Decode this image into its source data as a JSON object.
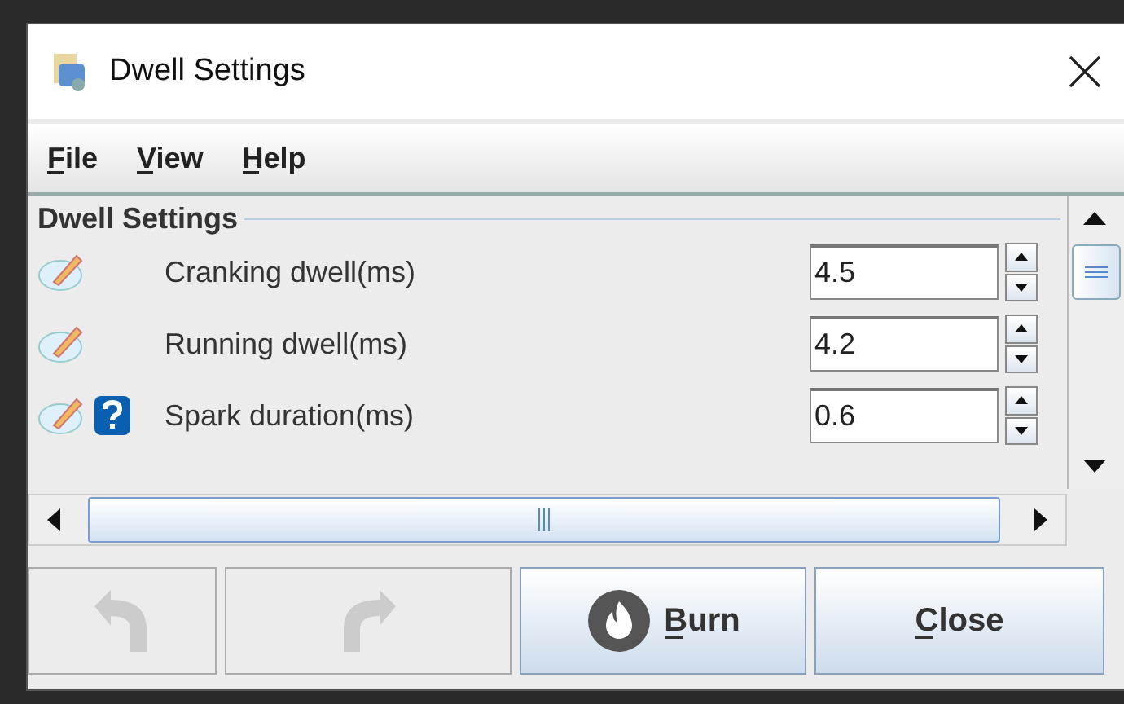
{
  "window": {
    "title": "Dwell Settings"
  },
  "menu": [
    "File",
    "View",
    "Help"
  ],
  "group": {
    "title": "Dwell Settings"
  },
  "rows": [
    {
      "label": "Cranking dwell(ms)",
      "value": "4.5",
      "help": false
    },
    {
      "label": "Running dwell(ms)",
      "value": "4.2",
      "help": false
    },
    {
      "label": "Spark duration(ms)",
      "value": "0.6",
      "help": true
    }
  ],
  "buttons": [
    {
      "kind": "undo",
      "disabled": true
    },
    {
      "kind": "redo",
      "disabled": true
    },
    {
      "kind": "burn",
      "label": "Burn",
      "disabled": false
    },
    {
      "kind": "close",
      "label": "Close",
      "disabled": false
    }
  ]
}
